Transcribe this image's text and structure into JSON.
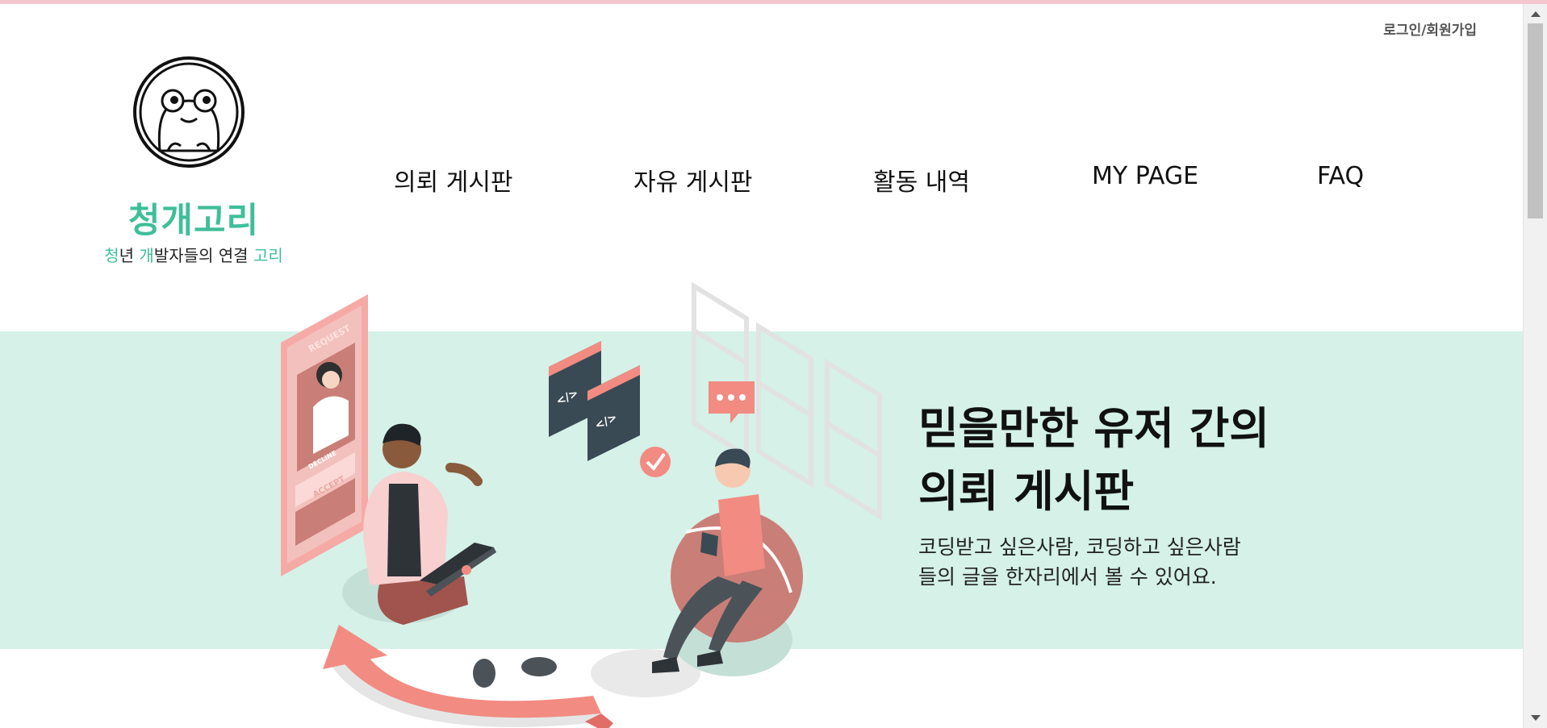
{
  "header": {
    "login_link": "로그인/회원가입",
    "brand_name": "청개고리",
    "tagline": {
      "p1": "청",
      "p2": "년 ",
      "p3": "개",
      "p4": "발자들의 연결 ",
      "p5": "고리"
    }
  },
  "nav": {
    "items": [
      {
        "label": "의뢰 게시판"
      },
      {
        "label": "자유 게시판"
      },
      {
        "label": "활동 내역"
      },
      {
        "label": "MY PAGE"
      },
      {
        "label": "FAQ"
      }
    ]
  },
  "hero": {
    "title_line1": "믿을만한 유저 간의",
    "title_line2": "의뢰 게시판",
    "desc_line1": "코딩받고 싶은사람, 코딩하고 싶은사람",
    "desc_line2": "들의 글을 한자리에서 볼 수 있어요.",
    "phone_request": "REQUEST",
    "phone_decline": "DECLINE",
    "phone_accept": "ACCEPT"
  },
  "colors": {
    "brand_green": "#3fbf99",
    "band_mint": "#d5f1e8",
    "accent_salmon": "#f28b82"
  },
  "icons": [
    "frog-logo-icon",
    "code-window-icon",
    "check-badge-icon",
    "chat-bubble-icon",
    "arrow-icon"
  ]
}
